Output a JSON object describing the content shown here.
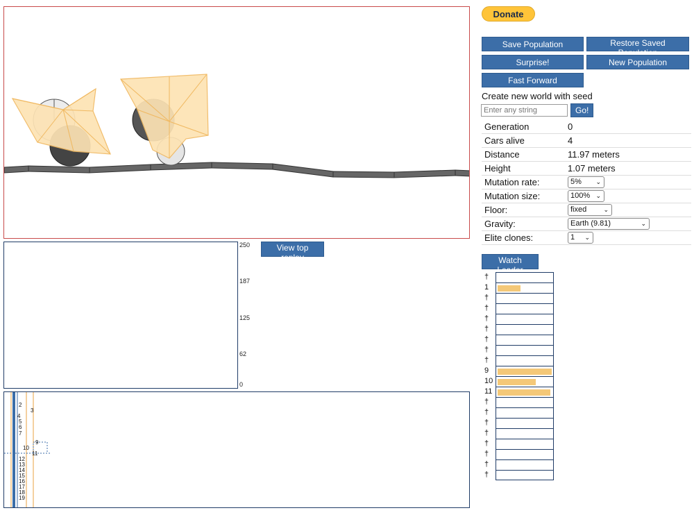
{
  "donate": {
    "label": "Donate"
  },
  "buttons": {
    "save_population": "Save Population",
    "restore_population": "Restore Saved Population",
    "surprise": "Surprise!",
    "new_population": "New Population",
    "fast_forward": "Fast Forward",
    "go": "Go!",
    "view_top_replay": "View top replay",
    "watch_leader": "Watch Leader"
  },
  "seed": {
    "label": "Create new world with seed",
    "placeholder": "Enter any string"
  },
  "stats": {
    "generation": {
      "label": "Generation",
      "value": "0"
    },
    "cars_alive": {
      "label": "Cars alive",
      "value": "4"
    },
    "distance": {
      "label": "Distance",
      "value": "11.97 meters"
    },
    "height": {
      "label": "Height",
      "value": "1.07 meters"
    },
    "mutation_rate": {
      "label": "Mutation rate:",
      "value": "5%"
    },
    "mutation_size": {
      "label": "Mutation size:",
      "value": "100%"
    },
    "floor": {
      "label": "Floor:",
      "value": "fixed"
    },
    "gravity": {
      "label": "Gravity:",
      "value": "Earth (9.81)"
    },
    "elite_clones": {
      "label": "Elite clones:",
      "value": "1"
    }
  },
  "graph": {
    "y_ticks": [
      "250",
      "187",
      "125",
      "62",
      "0"
    ]
  },
  "cars": [
    {
      "tag": "†",
      "fill": 0
    },
    {
      "tag": "1",
      "fill": 0.42
    },
    {
      "tag": "†",
      "fill": 0
    },
    {
      "tag": "†",
      "fill": 0
    },
    {
      "tag": "†",
      "fill": 0
    },
    {
      "tag": "†",
      "fill": 0
    },
    {
      "tag": "†",
      "fill": 0
    },
    {
      "tag": "†",
      "fill": 0
    },
    {
      "tag": "†",
      "fill": 0
    },
    {
      "tag": "9",
      "fill": 1.0
    },
    {
      "tag": "10",
      "fill": 0.7
    },
    {
      "tag": "11",
      "fill": 0.98
    },
    {
      "tag": "†",
      "fill": 0
    },
    {
      "tag": "†",
      "fill": 0
    },
    {
      "tag": "†",
      "fill": 0
    },
    {
      "tag": "†",
      "fill": 0
    },
    {
      "tag": "†",
      "fill": 0
    },
    {
      "tag": "†",
      "fill": 0
    },
    {
      "tag": "†",
      "fill": 0
    },
    {
      "tag": "†",
      "fill": 0
    }
  ],
  "minimap_labels": [
    "2",
    "3",
    "4",
    "5",
    "6",
    "7",
    "9",
    "10",
    "11",
    "12",
    "13",
    "14",
    "15",
    "16",
    "17",
    "18",
    "19"
  ],
  "colors": {
    "button": "#3c6ea8",
    "chassis": "#fde3b4",
    "chassis_stroke": "#f0b860",
    "ground": "#666666",
    "bar": "#f4c878"
  }
}
